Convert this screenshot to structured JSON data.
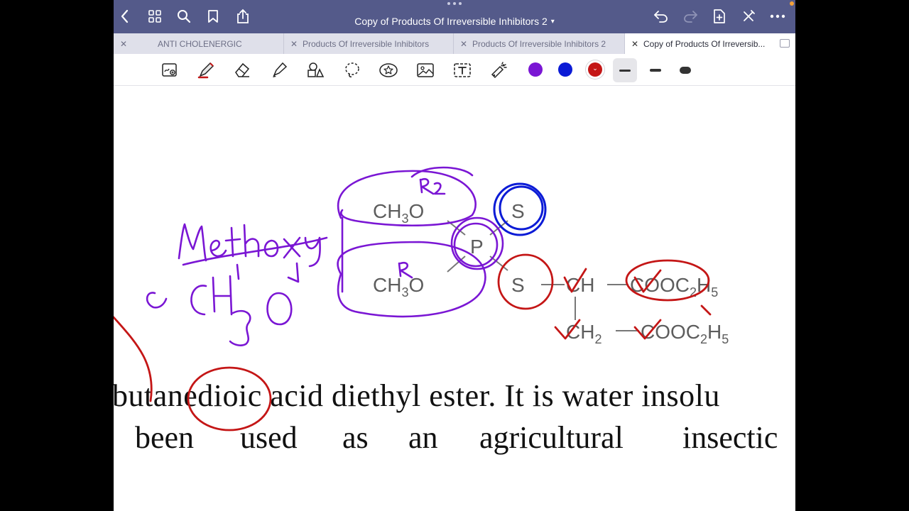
{
  "window": {
    "title": "Copy of Products Of Irreversible Inhibitors 2"
  },
  "tabs": [
    {
      "label": "ANTI CHOLENERGIC",
      "active": false
    },
    {
      "label": "Products Of Irreversible Inhibitors",
      "active": false
    },
    {
      "label": "Products Of Irreversible Inhibitors 2",
      "active": false
    },
    {
      "label": "Copy of Products Of Irreversib...",
      "active": true
    }
  ],
  "toolbar": {
    "tools": [
      "lasso-zoom",
      "pen",
      "eraser",
      "highlighter",
      "shapes",
      "lasso",
      "elements",
      "image",
      "text",
      "laser-pointer"
    ],
    "selected_tool": "pen",
    "colors": [
      "#7a16d4",
      "#0b1bd6",
      "#c41616"
    ],
    "selected_color": "#c41616",
    "stroke_widths": [
      "thin",
      "medium",
      "thick"
    ],
    "selected_stroke": "thin"
  },
  "molecule": {
    "group_top": "CH",
    "group_top_sub": "3",
    "group_top_end": "O",
    "group_bottom": "CH",
    "group_bottom_sub": "3",
    "group_bottom_end": "O",
    "thio_sulfur": "S",
    "phosphorus": "P",
    "thioether_sulfur": "S",
    "ch": "CH",
    "ester1": "COOC",
    "ester1_sub": "2",
    "ester1_end": "H",
    "ester1_sub2": "5",
    "ch2": "CH",
    "ch2_sub": "2",
    "ester2": "COOC",
    "ester2_sub": "2",
    "ester2_end": "H",
    "ester2_sub2": "5"
  },
  "document": {
    "line1": "butanedioic acid diethyl ester. It is water insolu",
    "line2_words": [
      "been",
      "used",
      "as",
      "an",
      "agricultural",
      "insectic"
    ]
  },
  "annotations": {
    "methoxy_label": "Methoxy",
    "formula_label": "CH3O",
    "r1_label": "R",
    "r2_label": "R2"
  }
}
